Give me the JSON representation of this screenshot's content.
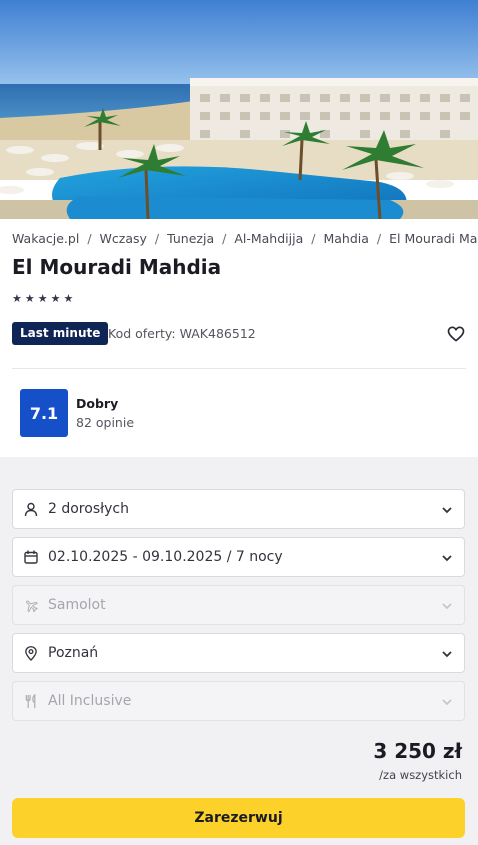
{
  "hero": {
    "image_alt": "Hotel El Mouradi Mahdia - pool and beach"
  },
  "breadcrumb": [
    {
      "label": "Wakacje.pl"
    },
    {
      "label": "Wczasy"
    },
    {
      "label": "Tunezja"
    },
    {
      "label": "Al-Mahdijja"
    },
    {
      "label": "Mahdia"
    },
    {
      "label": "El Mouradi Mahdia"
    }
  ],
  "hotel": {
    "name": "El Mouradi Mahdia",
    "stars": 5,
    "badge": "Last minute",
    "offer_code": "Kod oferty: WAK486512"
  },
  "rating": {
    "score": "7.1",
    "label": "Dobry",
    "reviews": "82 opinie",
    "color": "#1550c9"
  },
  "booking": {
    "travelers": "2 dorosłych",
    "dates": "02.10.2025 - 09.10.2025 / 7 nocy",
    "transport": "Samolot",
    "departure": "Poznań",
    "board": "All Inclusive"
  },
  "price": {
    "amount": "3 250 zł",
    "note": "/za wszystkich"
  },
  "cta": {
    "label": "Zarezerwuj",
    "color": "#fcd12a"
  }
}
